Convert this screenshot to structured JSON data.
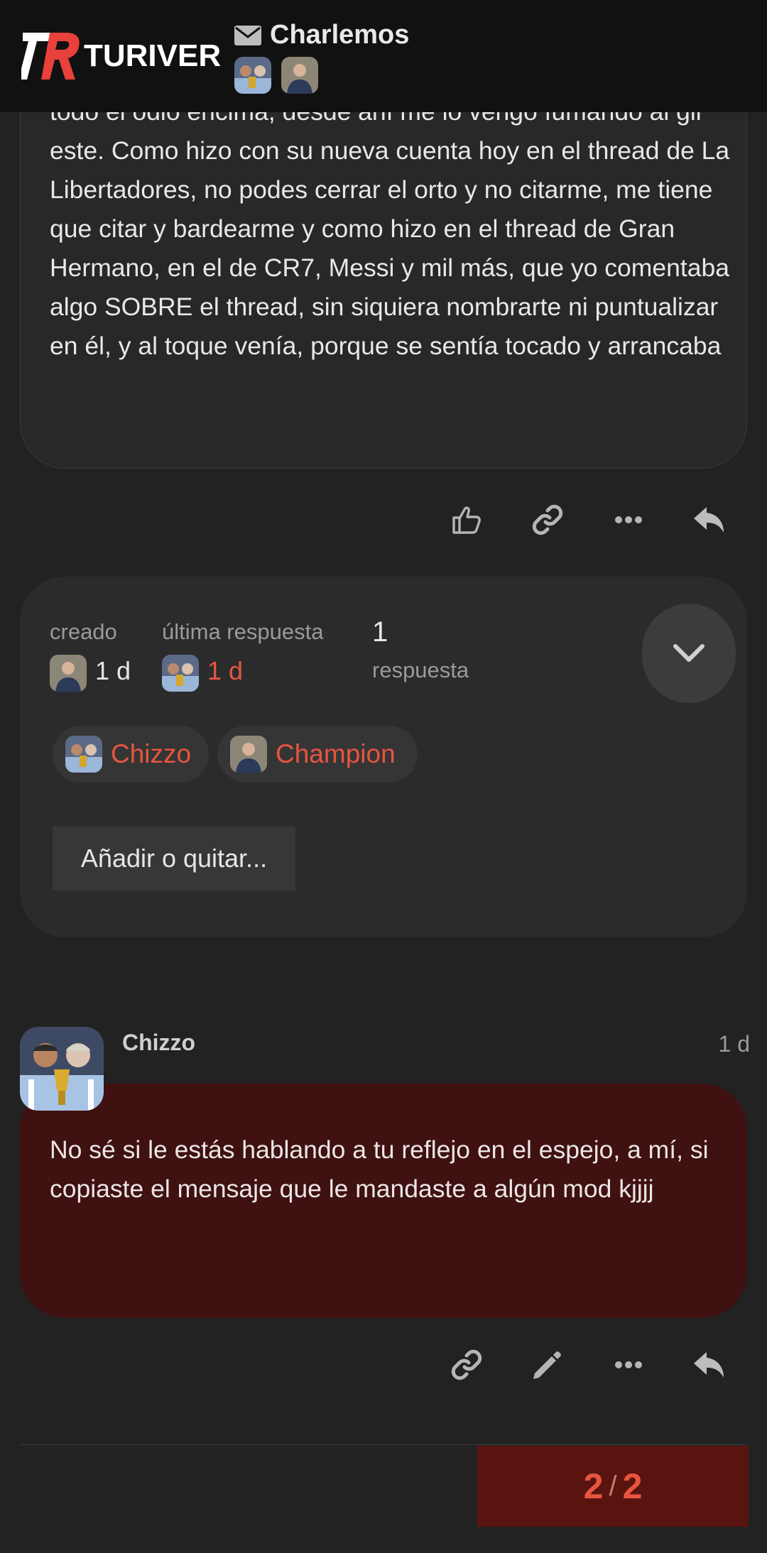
{
  "header": {
    "logo_text": "TURIVER",
    "topic_title": "Charlemos"
  },
  "post1": {
    "text": "todo el odio encima, desde ahí me lo vengo fumando al gil este. Como hizo con su nueva cuenta hoy en el thread de La Libertadores, no podes cerrar el orto y no citarme, me tiene que citar y bardearme y como hizo en el thread de Gran Hermano, en el de CR7, Messi y mil más, que yo comentaba algo SOBRE el thread, sin siquiera nombrarte ni puntualizar en él, y al toque venía, porque se sentía tocado y arrancaba"
  },
  "topic_map": {
    "created_label": "creado",
    "created_value": "1 d",
    "last_reply_label": "última respuesta",
    "last_reply_value": "1 d",
    "replies_count": "1",
    "replies_label": "respuesta",
    "participants": [
      {
        "name": "Chizzo"
      },
      {
        "name": "Champion"
      }
    ],
    "add_remove_label": "Añadir o quitar..."
  },
  "post2": {
    "username": "Chizzo",
    "time": "1 d",
    "text": "No sé si le estás hablando a tu reflejo en el espejo, a mí, si copiaste el mensaje que le mandaste a algún mod kjjjj"
  },
  "progress": {
    "current": "2",
    "separator": "/",
    "total": "2"
  },
  "colors": {
    "accent": "#e8553f",
    "header_bg": "#111111",
    "page_bg": "#222222",
    "highlight_bubble": "#3f1110",
    "progress_bg": "#5a1410"
  },
  "icons": [
    "envelope-icon",
    "like-icon",
    "link-icon",
    "more-icon",
    "reply-icon",
    "edit-icon",
    "chevron-down-icon"
  ]
}
